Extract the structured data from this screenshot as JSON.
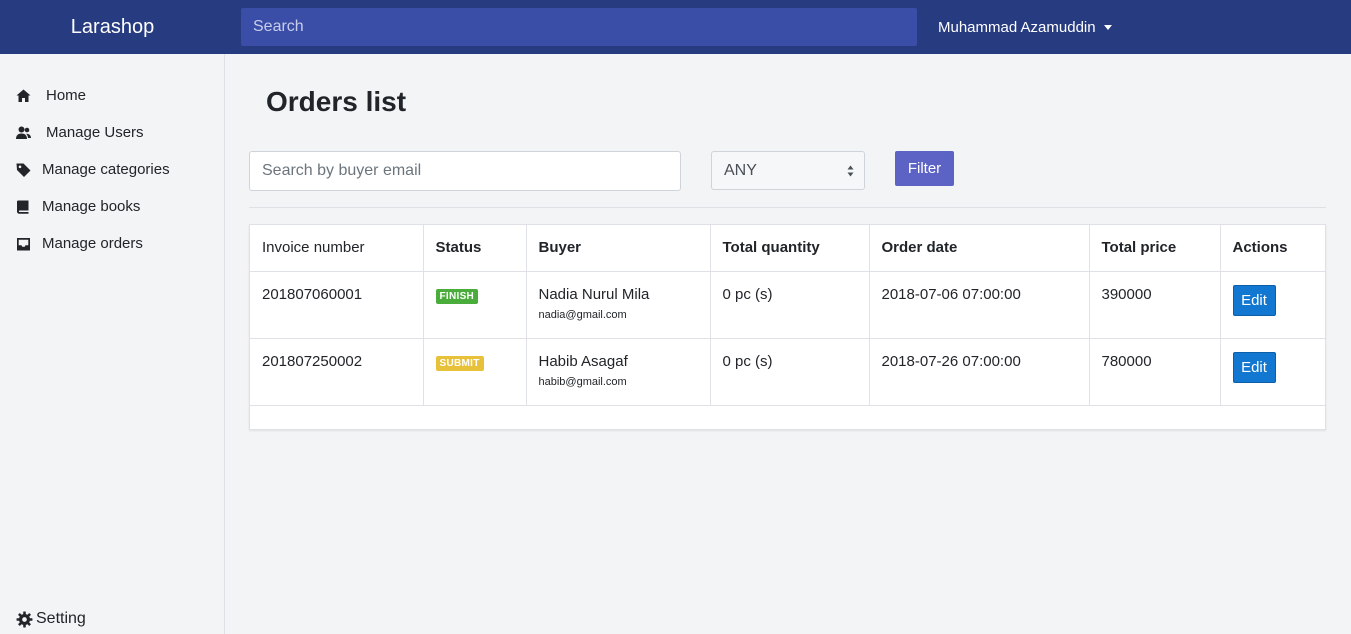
{
  "app": {
    "brand": "Larashop"
  },
  "navbar": {
    "search_placeholder": "Search",
    "user_name": "Muhammad Azamuddin"
  },
  "sidebar": {
    "items": [
      {
        "label": "Home",
        "icon": "home-icon"
      },
      {
        "label": "Manage Users",
        "icon": "users-icon"
      },
      {
        "label": "Manage categories",
        "icon": "tag-icon"
      },
      {
        "label": "Manage books",
        "icon": "book-icon"
      },
      {
        "label": "Manage orders",
        "icon": "inbox-icon"
      }
    ],
    "setting_label": "Setting"
  },
  "main": {
    "title": "Orders list",
    "search_placeholder": "Search by buyer email",
    "status_value": "ANY",
    "filter_label": "Filter"
  },
  "table": {
    "headers": [
      "Invoice number",
      "Status",
      "Buyer",
      "Total quantity",
      "Order date",
      "Total price",
      "Actions"
    ],
    "rows": [
      {
        "invoice": "201807060001",
        "status": "FINISH",
        "buyer_name": "Nadia Nurul Mila",
        "buyer_email": "nadia@gmail.com",
        "quantity": "0 pc (s)",
        "date": "2018-07-06 07:00:00",
        "price": "390000",
        "action": "Edit"
      },
      {
        "invoice": "201807250002",
        "status": "SUBMIT",
        "buyer_name": "Habib Asagaf",
        "buyer_email": "habib@gmail.com",
        "quantity": "0 pc (s)",
        "date": "2018-07-26 07:00:00",
        "price": "780000",
        "action": "Edit"
      }
    ]
  },
  "colors": {
    "navbar": "#263b80",
    "nav_search": "#3a4ea7",
    "filter_button": "#5d63c5",
    "edit_button": "#1177d1",
    "status_finish": "#4aad3b",
    "status_submit": "#e8c13a"
  }
}
